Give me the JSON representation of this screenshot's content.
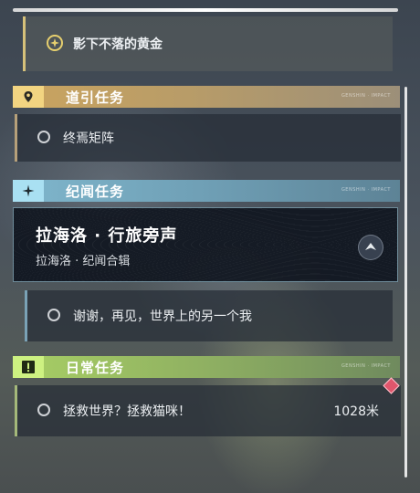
{
  "top_quest": {
    "title": "影下不落的黄金",
    "icon": "golden-quest-icon"
  },
  "sections": {
    "story": {
      "label": "道引任务",
      "fine": "GENSHIN · IMPACT",
      "icon": "location-pin-icon",
      "color": "#caa45f"
    },
    "world": {
      "label": "纪闻任务",
      "fine": "GENSHIN · IMPACT",
      "icon": "sparkle-star-icon",
      "color": "#7fb6cc"
    },
    "daily": {
      "label": "日常任务",
      "fine": "GENSHIN · IMPACT",
      "icon": "exclamation-box-icon",
      "color": "#a8cf64"
    }
  },
  "story_quests": [
    {
      "title": "终焉矩阵"
    }
  ],
  "world_series": {
    "title": "拉海洛 · 行旅旁声",
    "subtitle": "拉海洛 · 纪闻合辑",
    "icon": "collapse-arrow-icon"
  },
  "world_quests": [
    {
      "title": "谢谢，再见，世界上的另一个我"
    }
  ],
  "daily_quests": [
    {
      "title": "拯救世界？拯救猫咪！",
      "distance": "1028米",
      "badge": "red-diamond-icon"
    }
  ]
}
